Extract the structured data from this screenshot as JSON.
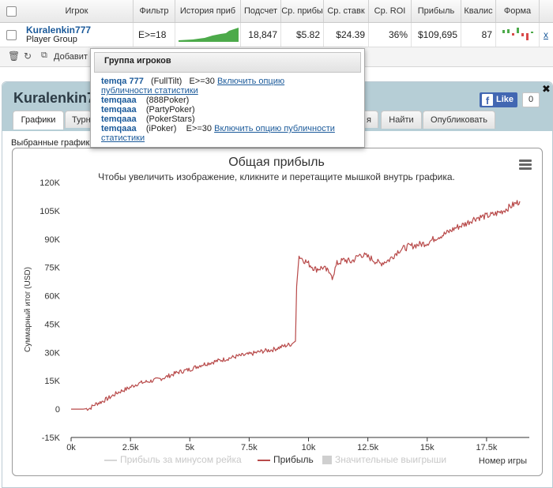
{
  "grid": {
    "headers": [
      "Игрок",
      "Фильтр",
      "История приб",
      "Подсчет",
      "Ср. прибы",
      "Ср. ставк",
      "Ср. ROI",
      "Прибыль",
      "Квалис",
      "Форма"
    ],
    "row": {
      "player": "Kuralenkin777",
      "group": "Player Group",
      "filter": "E>=18",
      "hands": "18,847",
      "avg_profit": "$5.82",
      "avg_stake": "$24.39",
      "avg_roi": "36%",
      "profit": "$109,695",
      "qual": "87",
      "remove": "x"
    }
  },
  "toolbar": {
    "add_label": "Добавит"
  },
  "popup": {
    "title": "Группа игроков",
    "entries": [
      {
        "name": "temqa 777",
        "site": "(FullTilt)",
        "filter": "E>=30",
        "link_line1": "Включить опцию",
        "link_line2": "публичности статистики"
      },
      {
        "name": "temqaaa",
        "site": "(888Poker)"
      },
      {
        "name": "temqaaa",
        "site": "(PartyPoker)"
      },
      {
        "name": "temqaaa",
        "site": "(PokerStars)"
      },
      {
        "name": "temqaaa",
        "site": "(iPoker)",
        "filter": "E>=30",
        "link_line1": "Включить опцию публичности",
        "link_line2": "статистики"
      }
    ]
  },
  "panel": {
    "title": "Kuralenkin777",
    "fb_like": "Like",
    "fb_count": "0",
    "close": "✖",
    "tabs": [
      "Графики",
      "Турн",
      "я",
      "Найти",
      "Опубликовать"
    ],
    "selected_charts": "Выбранные графики"
  },
  "chart_data": {
    "type": "line",
    "title": "Общая прибыль",
    "subtitle": "Чтобы увеличить изображение, кликните и перетащите мышкой внутрь графика.",
    "xlabel": "Номер игры",
    "ylabel": "Суммарный итог (USD)",
    "xlim": [
      0,
      19300
    ],
    "ylim": [
      -15000,
      120000
    ],
    "x_ticks": [
      0,
      2500,
      5000,
      7500,
      10000,
      12500,
      15000,
      17500
    ],
    "x_tick_labels": [
      "0k",
      "2.5k",
      "5k",
      "7.5k",
      "10k",
      "12.5k",
      "15k",
      "17.5k"
    ],
    "y_ticks": [
      -15000,
      0,
      15000,
      30000,
      45000,
      60000,
      75000,
      90000,
      105000,
      120000
    ],
    "y_tick_labels": [
      "-15K",
      "0",
      "15K",
      "30K",
      "45K",
      "60K",
      "75K",
      "90K",
      "105K",
      "120K"
    ],
    "series": [
      {
        "name": "Прибыль",
        "color": "#b84a4a",
        "visible": true,
        "x": [
          0,
          500,
          800,
          1000,
          1300,
          1600,
          2000,
          2400,
          2800,
          3200,
          3600,
          4000,
          4500,
          5000,
          5500,
          6000,
          6500,
          7000,
          7500,
          8000,
          8500,
          9000,
          9300,
          9450,
          9500,
          9600,
          9800,
          10000,
          10300,
          10600,
          10900,
          11000,
          11200,
          11500,
          11800,
          12200,
          12600,
          13000,
          13400,
          13800,
          14200,
          14600,
          15000,
          15400,
          15800,
          16200,
          16600,
          17000,
          17400,
          17800,
          18200,
          18600,
          18900
        ],
        "y": [
          0,
          0,
          500,
          2500,
          4000,
          6000,
          9000,
          11000,
          13500,
          14500,
          15500,
          17000,
          19500,
          21000,
          23500,
          25000,
          26500,
          28000,
          29000,
          30500,
          31500,
          33500,
          34500,
          36000,
          65000,
          81000,
          79000,
          77000,
          74000,
          75000,
          72000,
          70000,
          77000,
          79000,
          78000,
          82000,
          80000,
          77000,
          79000,
          84000,
          86000,
          87000,
          88000,
          91000,
          93000,
          96000,
          98000,
          101000,
          102000,
          103000,
          105000,
          108000,
          110000
        ]
      },
      {
        "name": "Прибыль за минусом рейка",
        "color": "#c8c8c8",
        "visible": false
      },
      {
        "name": "Значительные выигрыши",
        "color": "#c8c8c8",
        "visible": false
      }
    ],
    "legend_position": "bottom",
    "grid": false
  }
}
